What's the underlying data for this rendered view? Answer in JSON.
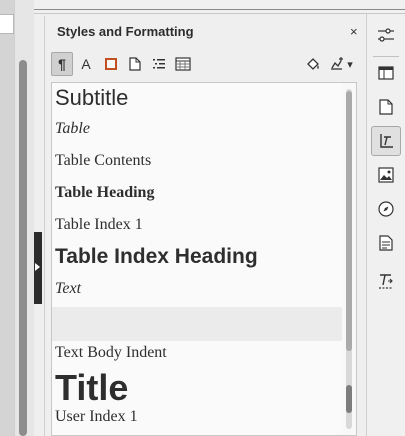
{
  "panel": {
    "title": "Styles and Formatting",
    "close_glyph": "×"
  },
  "toolbar": {
    "buttons": [
      {
        "name": "paragraph-styles-icon",
        "glyph": "¶",
        "active": true
      },
      {
        "name": "character-styles-icon",
        "glyph": "A",
        "active": false
      },
      {
        "name": "frame-styles-icon",
        "glyph": "",
        "active": false
      },
      {
        "name": "page-styles-icon",
        "glyph": "",
        "active": false
      },
      {
        "name": "list-styles-icon",
        "glyph": "",
        "active": false
      },
      {
        "name": "table-styles-icon",
        "glyph": "",
        "active": false
      },
      {
        "name": "fill-format-mode-icon",
        "glyph": "",
        "active": false
      },
      {
        "name": "new-style-from-selection-icon",
        "glyph": "",
        "active": false
      },
      {
        "name": "dropdown-arrow-icon",
        "glyph": "▾",
        "active": false
      }
    ]
  },
  "styles": [
    {
      "label": "Subtitle"
    },
    {
      "label": "Table"
    },
    {
      "label": "Table Contents"
    },
    {
      "label": "Table Heading"
    },
    {
      "label": "Table Index 1"
    },
    {
      "label": "Table Index Heading"
    },
    {
      "label": "Text"
    },
    {
      "label": "Text Body Indent"
    },
    {
      "label": "Title"
    },
    {
      "label": "User Index 1"
    }
  ],
  "colors": {
    "active_tab_bg": "#e0e0e0",
    "frame_icon_accent": "#c0501f",
    "handle": "#2b2b2b"
  },
  "sidebar_tabs": [
    {
      "name": "properties-tab-icon",
      "active": false
    },
    {
      "name": "page-tab-icon",
      "active": false
    },
    {
      "name": "styles-tab-icon",
      "active": true
    },
    {
      "name": "gallery-tab-icon",
      "active": false
    },
    {
      "name": "navigator-tab-icon",
      "active": false
    },
    {
      "name": "manage-changes-tab-icon",
      "active": false
    },
    {
      "name": "design-tab-icon",
      "active": false
    }
  ]
}
